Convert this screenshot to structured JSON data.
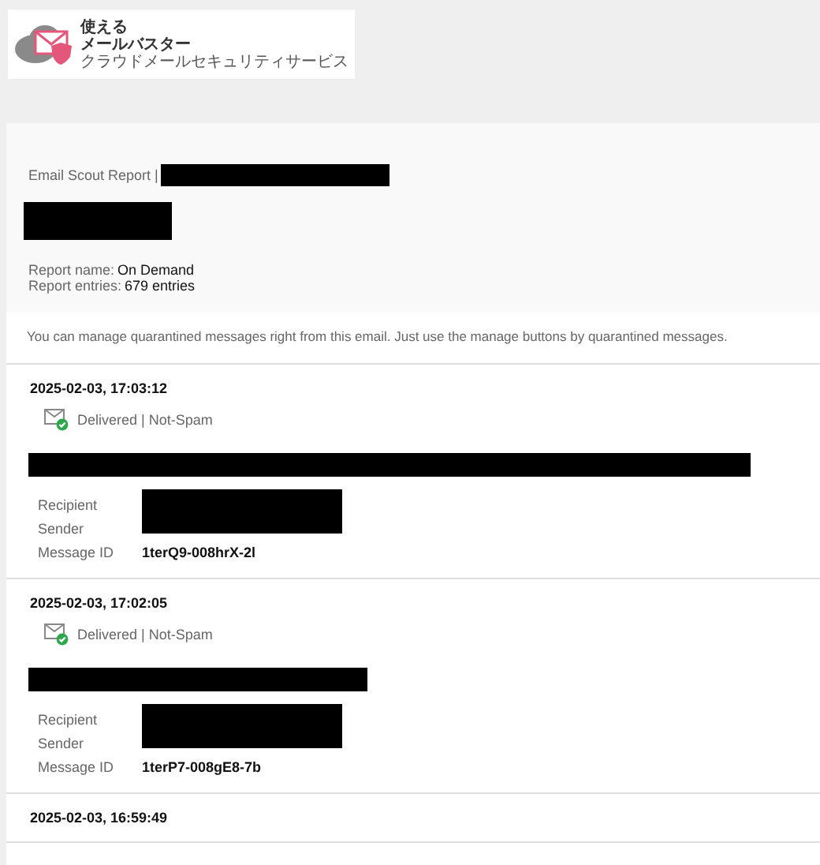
{
  "logo": {
    "line_1": "使える",
    "line_2": "メールバスター",
    "tagline": "クラウドメールセキュリティサービス"
  },
  "report": {
    "title": "Email Scout Report |",
    "fields": [
      {
        "label": "Report name:",
        "value": "On Demand"
      },
      {
        "label": "Report entries:",
        "value": "679 entries"
      }
    ]
  },
  "notice": "You can manage quarantined messages right from this email. Just use the manage buttons by quarantined messages.",
  "messages": [
    {
      "date": "2025-02-03, 17:03:12",
      "status": "Delivered | Not-Spam",
      "fields": [
        {
          "label": "Recipient"
        },
        {
          "label": "Sender"
        },
        {
          "label": "Message ID",
          "value": "1terQ9-008hrX-2l"
        }
      ]
    },
    {
      "date": "2025-02-03, 17:02:05",
      "status": "Delivered | Not-Spam",
      "fields": [
        {
          "label": "Recipient"
        },
        {
          "label": "Sender"
        },
        {
          "label": "Message ID",
          "value": "1terP7-008gE8-7b"
        }
      ]
    },
    {
      "date": "2025-02-03, 16:59:49"
    }
  ]
}
